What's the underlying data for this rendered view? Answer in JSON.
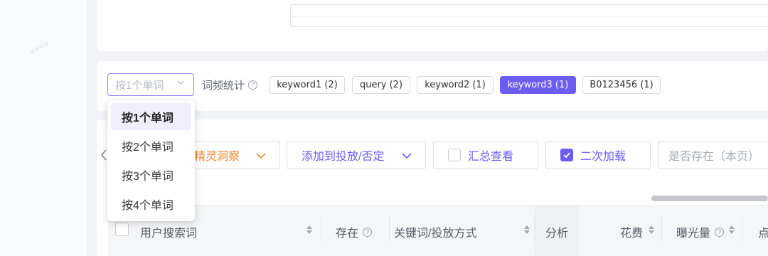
{
  "filter": {
    "select_placeholder": "按1个单词",
    "freq_label": "词频统计",
    "help_glyph": "?",
    "keywords": [
      {
        "label": "keyword1 (2)",
        "active": false
      },
      {
        "label": "query (2)",
        "active": false
      },
      {
        "label": "keyword2 (1)",
        "active": false
      },
      {
        "label": "keyword3 (1)",
        "active": true
      },
      {
        "label": "B0123456 (1)",
        "active": false
      }
    ]
  },
  "dropdown": {
    "options": [
      "按1个单词",
      "按2个单词",
      "按3个单词",
      "按4个单词"
    ],
    "selected_index": 0
  },
  "toolbar": {
    "insight_label": "精灵洞察",
    "add_label": "添加到投放/否定",
    "summary_label": "汇总查看",
    "summary_checked": false,
    "reload_label": "二次加载",
    "reload_checked": true,
    "exist_placeholder": "是否存在（本页）"
  },
  "table": {
    "headers": {
      "search_term": "用户搜索词",
      "exists": "存在",
      "keyword_mode": "关键词/投放方式",
      "analysis": "分析",
      "cost": "花费",
      "impressions": "曝光量",
      "clicks": "点"
    }
  },
  "colors": {
    "accent": "#6c5cf0",
    "orange": "#f0882f",
    "page_bg": "#f2f3f6"
  },
  "icons": {
    "chevron": "chevron-down-icon",
    "help": "help-circle-icon",
    "sort": "sort-icon",
    "check": "check-icon",
    "back": "chevron-left-icon"
  }
}
